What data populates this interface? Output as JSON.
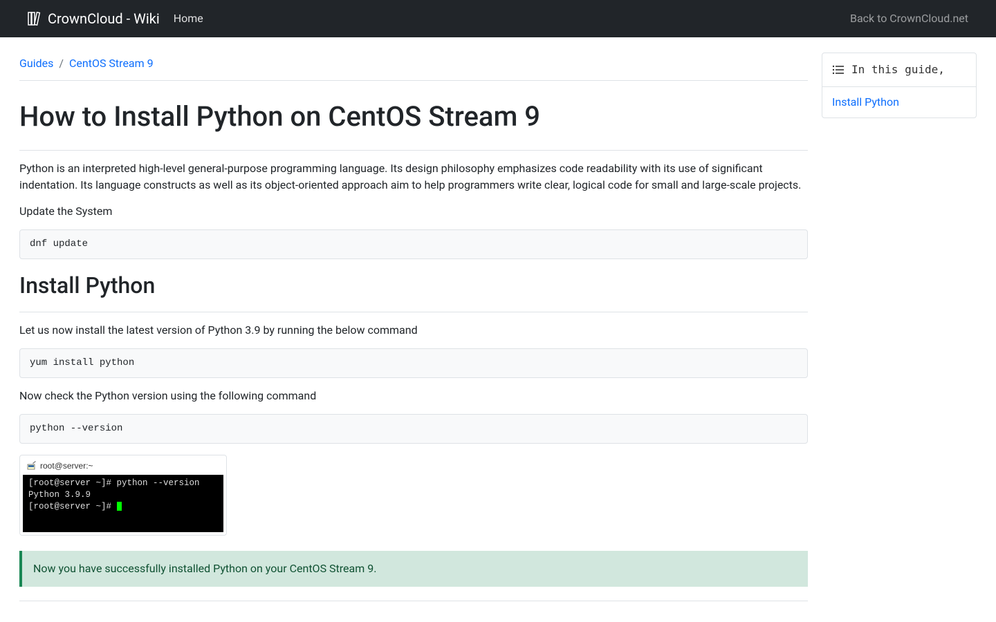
{
  "nav": {
    "brand": "CrownCloud - Wiki",
    "home": "Home",
    "back": "Back to CrownCloud.net"
  },
  "breadcrumb": {
    "items": [
      "Guides",
      "CentOS Stream 9"
    ]
  },
  "page": {
    "title": "How to Install Python on CentOS Stream 9",
    "intro": "Python is an interpreted high-level general-purpose programming language. Its design philosophy emphasizes code readability with its use of significant indentation. Its language constructs as well as its object-oriented approach aim to help programmers write clear, logical code for small and large-scale projects.",
    "update_label": "Update the System",
    "update_cmd": "dnf update",
    "h2_install": "Install Python",
    "install_text": "Let us now install the latest version of Python 3.9 by running the below command",
    "install_cmd": "yum install python",
    "check_text": "Now check the Python version using the following command",
    "check_cmd": "python --version",
    "terminal": {
      "title": "root@server:~",
      "line1_prompt": "[root@server ~]# ",
      "line1_cmd": "python --version",
      "line2": "Python 3.9.9",
      "line3_prompt": "[root@server ~]# "
    },
    "success": "Now you have successfully installed Python on your CentOS Stream 9."
  },
  "sidebar": {
    "header": "In this guide,",
    "items": [
      "Install Python"
    ]
  }
}
